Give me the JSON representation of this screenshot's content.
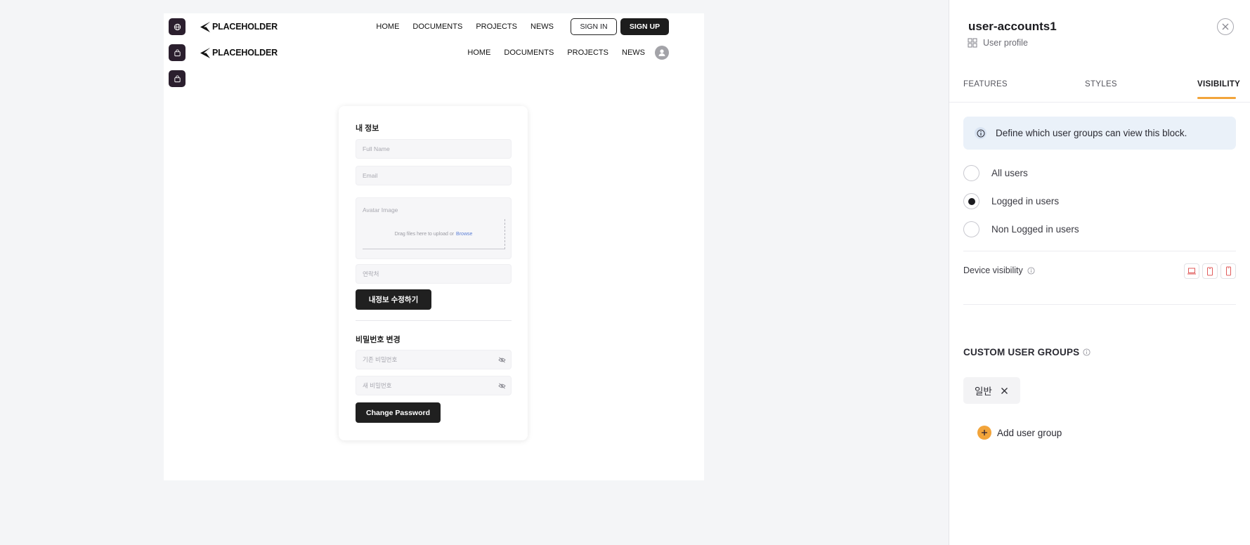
{
  "canvas": {
    "navbar1": {
      "logo": "PLACEHOLDER",
      "links": [
        "HOME",
        "DOCUMENTS",
        "PROJECTS",
        "NEWS"
      ],
      "signin": "SIGN IN",
      "signup": "SIGN UP"
    },
    "navbar2": {
      "logo": "PLACEHOLDER",
      "links": [
        "HOME",
        "DOCUMENTS",
        "PROJECTS",
        "NEWS"
      ]
    },
    "profile_form": {
      "title": "내 정보",
      "full_name_placeholder": "Full Name",
      "email_placeholder": "Email",
      "avatar_label": "Avatar Image",
      "upload_text": "Drag files here to upload or",
      "browse_text": "Browse",
      "contact_placeholder": "연락처",
      "submit_label": "내정보 수정하기"
    },
    "password_form": {
      "title": "비밀번호 변경",
      "current_placeholder": "기존 비밀번호",
      "new_placeholder": "새 비밀번호",
      "submit_label": "Change Password"
    }
  },
  "panel": {
    "title": "user-accounts1",
    "subtitle": "User profile",
    "tabs": [
      {
        "label": "FEATURES",
        "active": false
      },
      {
        "label": "STYLES",
        "active": false
      },
      {
        "label": "VISIBILITY",
        "active": true
      }
    ],
    "info_text": "Define which user groups can view this block.",
    "visibility_options": [
      {
        "label": "All users",
        "selected": false
      },
      {
        "label": "Logged in users",
        "selected": true
      },
      {
        "label": "Non Logged in users",
        "selected": false
      }
    ],
    "device_visibility_label": "Device visibility",
    "custom_groups_title": "CUSTOM USER GROUPS",
    "groups": [
      "일반"
    ],
    "add_group_label": "Add user group"
  },
  "colors": {
    "accent": "#f2a43a",
    "dark_button": "#202020",
    "block_chip": "#2b1f2e",
    "info_bg": "#eaf1f9",
    "device_icon": "#e05a5a"
  }
}
